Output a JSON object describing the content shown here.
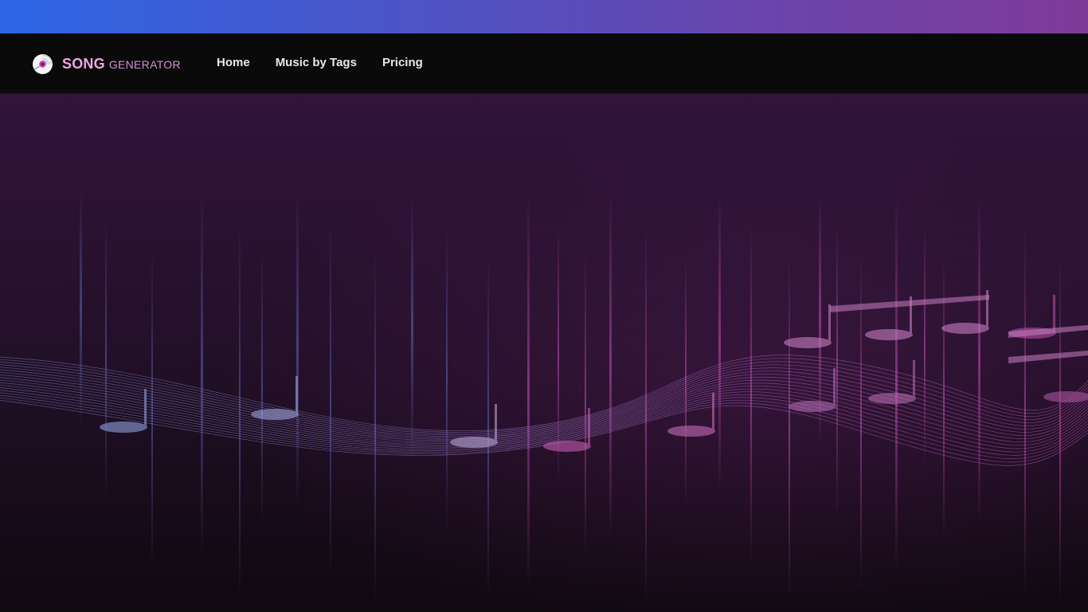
{
  "brand": {
    "name_strong": "SONG",
    "name_light": "GENERATOR",
    "icon": "vinyl-disc-icon",
    "accent_color": "#f2a5e2"
  },
  "nav": {
    "items": [
      {
        "label": "Home"
      },
      {
        "label": "Music by Tags"
      },
      {
        "label": "Pricing"
      }
    ]
  },
  "hero": {
    "image": "music-notes-wave-illustration"
  },
  "colors": {
    "top_bar_start": "#2c66e6",
    "top_bar_end": "#7f3a98",
    "nav_bg": "#0a0a0b",
    "hero_top": "#32133a",
    "hero_bottom": "#0f0910"
  }
}
